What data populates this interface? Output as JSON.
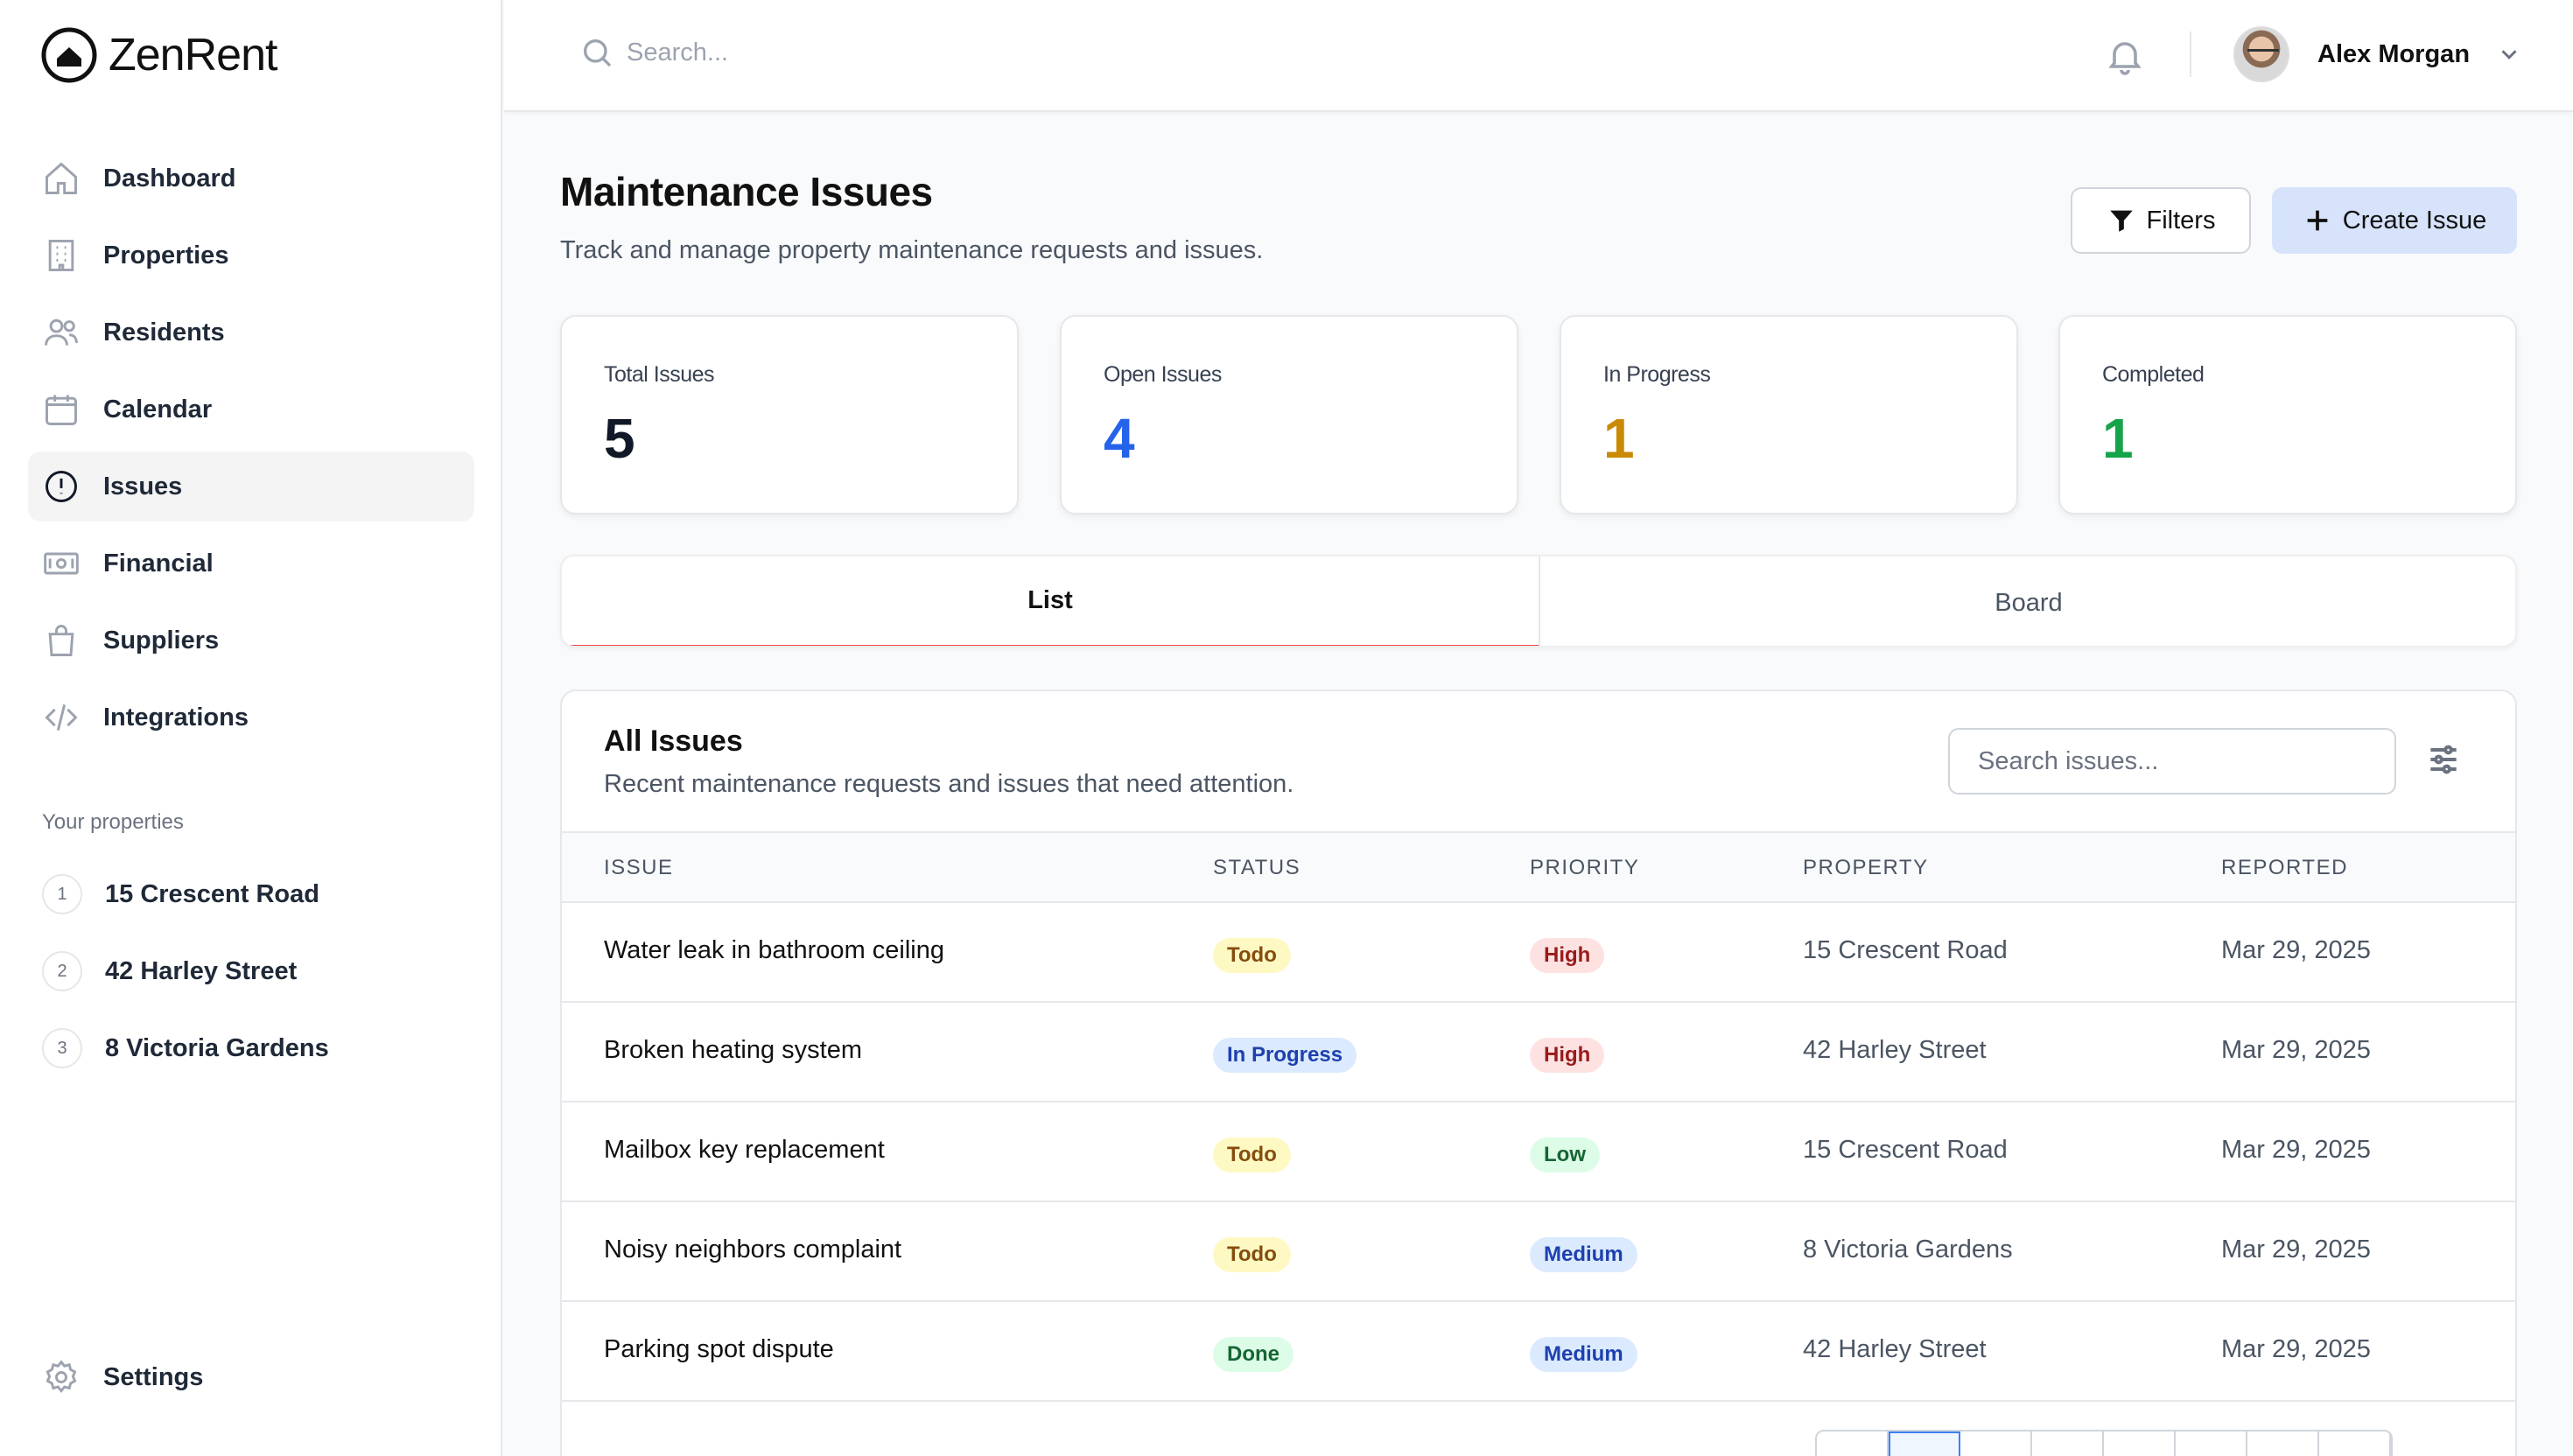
{
  "app": {
    "name": "ZenRent"
  },
  "sidebar": {
    "nav": [
      {
        "label": "Dashboard",
        "icon": "home-icon"
      },
      {
        "label": "Properties",
        "icon": "building-icon"
      },
      {
        "label": "Residents",
        "icon": "users-icon"
      },
      {
        "label": "Calendar",
        "icon": "calendar-icon"
      },
      {
        "label": "Issues",
        "icon": "alert-circle-icon",
        "active": true
      },
      {
        "label": "Financial",
        "icon": "banknote-icon"
      },
      {
        "label": "Suppliers",
        "icon": "shopping-bag-icon"
      },
      {
        "label": "Integrations",
        "icon": "code-icon"
      }
    ],
    "section_label": "Your properties",
    "properties": [
      {
        "num": "1",
        "label": "15 Crescent Road"
      },
      {
        "num": "2",
        "label": "42 Harley Street"
      },
      {
        "num": "3",
        "label": "8 Victoria Gardens"
      }
    ],
    "settings_label": "Settings"
  },
  "topbar": {
    "search_placeholder": "Search...",
    "user_name": "Alex Morgan"
  },
  "header": {
    "title": "Maintenance Issues",
    "subtitle": "Track and manage property maintenance requests and issues.",
    "filters_label": "Filters",
    "create_label": "Create Issue"
  },
  "stats": [
    {
      "label": "Total Issues",
      "value": "5",
      "color": "#111827"
    },
    {
      "label": "Open Issues",
      "value": "4",
      "color": "#2563eb"
    },
    {
      "label": "In Progress",
      "value": "1",
      "color": "#ca8a04"
    },
    {
      "label": "Completed",
      "value": "1",
      "color": "#16a34a"
    }
  ],
  "tabs": [
    {
      "label": "List",
      "active": true
    },
    {
      "label": "Board",
      "active": false
    }
  ],
  "issues_card": {
    "title": "All Issues",
    "subtitle": "Recent maintenance requests and issues that need attention.",
    "search_placeholder": "Search issues...",
    "columns": [
      "ISSUE",
      "STATUS",
      "PRIORITY",
      "PROPERTY",
      "REPORTED"
    ],
    "rows": [
      {
        "issue": "Water leak in bathroom ceiling",
        "status": "Todo",
        "priority": "High",
        "property": "15 Crescent Road",
        "reported": "Mar 29, 2025"
      },
      {
        "issue": "Broken heating system",
        "status": "In Progress",
        "priority": "High",
        "property": "42 Harley Street",
        "reported": "Mar 29, 2025"
      },
      {
        "issue": "Mailbox key replacement",
        "status": "Todo",
        "priority": "Low",
        "property": "15 Crescent Road",
        "reported": "Mar 29, 2025"
      },
      {
        "issue": "Noisy neighbors complaint",
        "status": "Todo",
        "priority": "Medium",
        "property": "8 Victoria Gardens",
        "reported": "Mar 29, 2025"
      },
      {
        "issue": "Parking spot dispute",
        "status": "Done",
        "priority": "Medium",
        "property": "42 Harley Street",
        "reported": "Mar 29, 2025"
      }
    ]
  },
  "badge_colors": {
    "Todo": {
      "bg": "#fef9c3",
      "fg": "#854d0e"
    },
    "In Progress": {
      "bg": "#dbeafe",
      "fg": "#1e40af"
    },
    "Done": {
      "bg": "#dcfce7",
      "fg": "#166534"
    },
    "High": {
      "bg": "#fee2e2",
      "fg": "#991b1b"
    },
    "Low": {
      "bg": "#dcfce7",
      "fg": "#166534"
    },
    "Medium": {
      "bg": "#dbeafe",
      "fg": "#1e40af"
    }
  }
}
